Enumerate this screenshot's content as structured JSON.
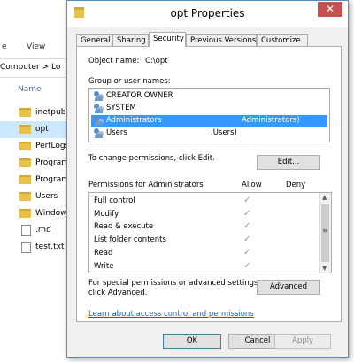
{
  "explorer": {
    "ribbon": [
      "e",
      "View"
    ],
    "address": "Computer > Lo",
    "column_header": "Name",
    "items": [
      {
        "name": "inetpub",
        "type": "folder",
        "selected": false
      },
      {
        "name": "opt",
        "type": "folder",
        "selected": true
      },
      {
        "name": "PerfLogs",
        "type": "folder",
        "selected": false
      },
      {
        "name": "Program",
        "type": "folder",
        "selected": false
      },
      {
        "name": "Program",
        "type": "folder",
        "selected": false
      },
      {
        "name": "Users",
        "type": "folder",
        "selected": false
      },
      {
        "name": "Window",
        "type": "folder",
        "selected": false
      },
      {
        "name": ".rnd",
        "type": "file",
        "selected": false
      },
      {
        "name": "test.txt",
        "type": "file",
        "selected": false
      }
    ]
  },
  "dialog": {
    "title": "opt Properties",
    "close_glyph": "✕",
    "tabs": [
      "General",
      "Sharing",
      "Security",
      "Previous Versions",
      "Customize"
    ],
    "active_tab": "Security",
    "object_name_label": "Object name:",
    "object_name_value": "C:\\opt",
    "group_label": "Group or user names:",
    "users": [
      {
        "name": "CREATOR OWNER",
        "extra": "",
        "selected": false
      },
      {
        "name": "SYSTEM",
        "extra": "",
        "selected": false
      },
      {
        "name": "Administrators",
        "extra": "Administrators)",
        "selected": true
      },
      {
        "name": "Users",
        "extra": ".Users)",
        "selected": false
      }
    ],
    "change_text": "To change permissions, click Edit.",
    "edit_button": "Edit...",
    "permissions_header": "Permissions for Administrators",
    "allow_header": "Allow",
    "deny_header": "Deny",
    "check_glyph": "✓",
    "permissions": [
      {
        "name": "Full control",
        "allow": true,
        "deny": false
      },
      {
        "name": "Modify",
        "allow": true,
        "deny": false
      },
      {
        "name": "Read & execute",
        "allow": true,
        "deny": false
      },
      {
        "name": "List folder contents",
        "allow": true,
        "deny": false
      },
      {
        "name": "Read",
        "allow": true,
        "deny": false
      },
      {
        "name": "Write",
        "allow": true,
        "deny": false
      }
    ],
    "special_text_1": "For special permissions or advanced settings,",
    "special_text_2": "click Advanced.",
    "advanced_button": "Advanced",
    "help_link": "Learn about access control and permissions",
    "ok_button": "OK",
    "cancel_button": "Cancel",
    "apply_button": "Apply"
  }
}
